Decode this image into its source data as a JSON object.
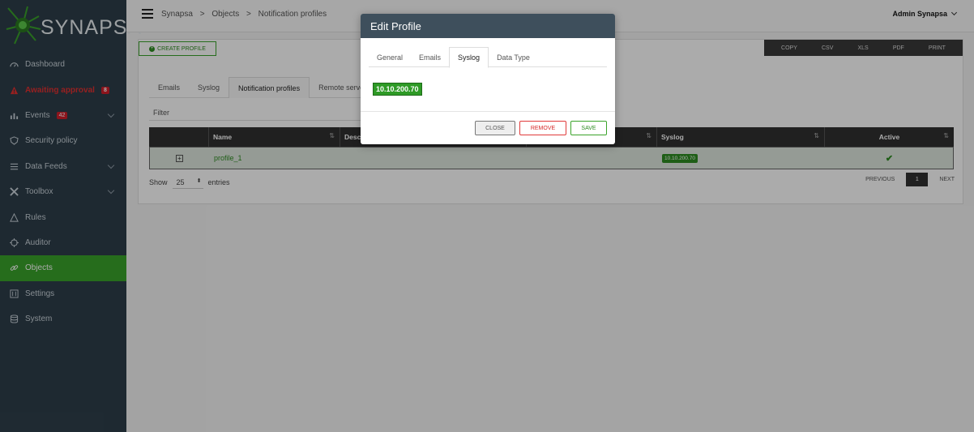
{
  "app": {
    "logo_text": "SYNAPSA"
  },
  "sidebar": {
    "items": [
      {
        "label": "Dashboard",
        "icon": "dashboard-icon"
      },
      {
        "label": "Awaiting approval",
        "icon": "warning-icon",
        "badge": "8"
      },
      {
        "label": "Events",
        "icon": "chart-icon",
        "badge": "42"
      },
      {
        "label": "Security policy",
        "icon": "shield-icon"
      },
      {
        "label": "Data Feeds",
        "icon": "list-icon"
      },
      {
        "label": "Toolbox",
        "icon": "tools-icon"
      },
      {
        "label": "Rules",
        "icon": "triangle-icon"
      },
      {
        "label": "Auditor",
        "icon": "crosshair-icon"
      },
      {
        "label": "Objects",
        "icon": "link-icon"
      },
      {
        "label": "Settings",
        "icon": "sliders-icon"
      },
      {
        "label": "System",
        "icon": "database-icon"
      }
    ]
  },
  "topbar": {
    "breadcrumb": [
      "Synapsa",
      "Objects",
      "Notification profiles"
    ],
    "breadcrumb_sep": ">",
    "user": "Admin Synapsa"
  },
  "toolbar": {
    "create_label": "CREATE PROFILE",
    "export": [
      "COPY",
      "CSV",
      "XLS",
      "PDF",
      "PRINT"
    ]
  },
  "tabs": [
    "Emails",
    "Syslog",
    "Notification profiles",
    "Remote servers"
  ],
  "filter": {
    "label": "Filter"
  },
  "table": {
    "columns": [
      "",
      "Name",
      "Desc",
      "",
      "Syslog",
      "Active"
    ],
    "rows": [
      {
        "expand": "+",
        "name": "profile_1",
        "syslog": "10.10.200.70",
        "active": "✔"
      }
    ]
  },
  "pagination": {
    "show_label": "Show",
    "entries_value": "25",
    "entries_label": "entries",
    "previous": "PREVIOUS",
    "page": "1",
    "next": "NEXT"
  },
  "modal": {
    "title": "Edit Profile",
    "tabs": [
      "General",
      "Emails",
      "Syslog",
      "Data Type"
    ],
    "syslog_ip": "10.10.200.70",
    "close_label": "CLOSE",
    "remove_label": "REMOVE",
    "save_label": "SAVE"
  },
  "colors": {
    "sidebar_bg": "#2e3e4a",
    "accent_green": "#3aa32a",
    "alert_red": "#d11f2a",
    "modal_header": "#3e4f5c"
  }
}
